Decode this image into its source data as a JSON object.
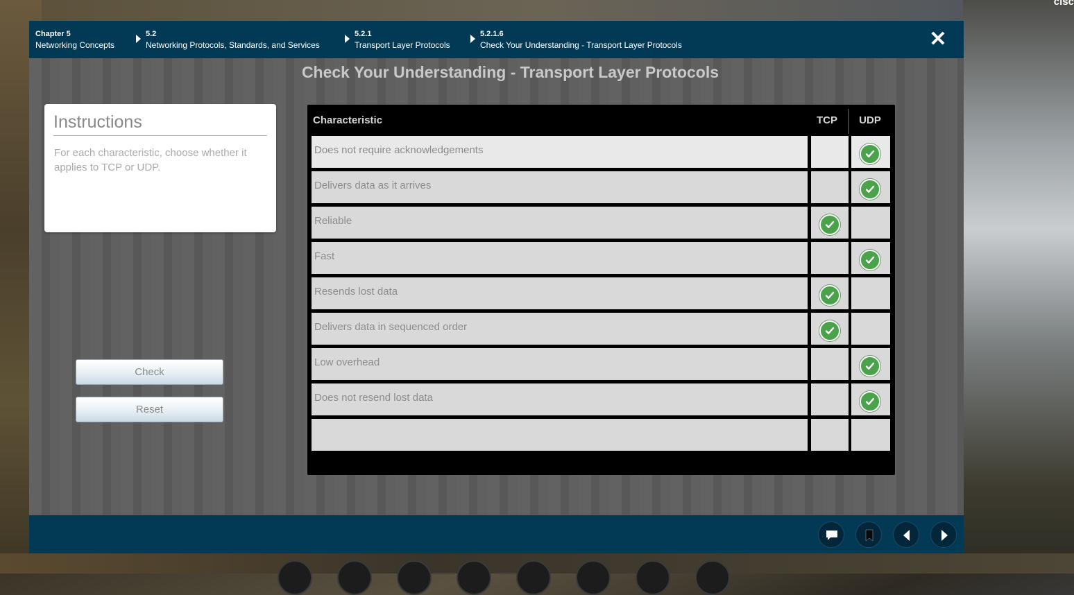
{
  "corner_brand": "cisc",
  "breadcrumbs": [
    {
      "num": "Chapter 5",
      "label": "Networking Concepts"
    },
    {
      "num": "5.2",
      "label": "Networking Protocols, Standards, and Services"
    },
    {
      "num": "5.2.1",
      "label": "Transport Layer Protocols"
    },
    {
      "num": "5.2.1.6",
      "label": "Check Your Understanding - Transport Layer Protocols"
    }
  ],
  "close_symbol": "✕",
  "activity_title": "Check Your Understanding - Transport Layer Protocols",
  "instructions": {
    "heading": "Instructions",
    "text": "For each characteristic, choose whether it applies to TCP or UDP."
  },
  "buttons": {
    "check": "Check",
    "reset": "Reset"
  },
  "table": {
    "headers": {
      "characteristic": "Characteristic",
      "tcp": "TCP",
      "udp": "UDP"
    },
    "rows": [
      {
        "label": "Does not require acknowledgements",
        "answer": "UDP"
      },
      {
        "label": "Delivers data as it arrives",
        "answer": "UDP"
      },
      {
        "label": "Reliable",
        "answer": "TCP"
      },
      {
        "label": "Fast",
        "answer": "UDP"
      },
      {
        "label": "Resends lost data",
        "answer": "TCP"
      },
      {
        "label": "Delivers data in sequenced order",
        "answer": "TCP"
      },
      {
        "label": "Low overhead",
        "answer": "UDP"
      },
      {
        "label": "Does not resend lost data",
        "answer": "UDP"
      },
      {
        "label": "",
        "answer": ""
      }
    ]
  },
  "footer_icons": [
    "comment-icon",
    "bookmark-icon",
    "previous-icon",
    "next-icon"
  ],
  "colors": {
    "nav": "#023a56",
    "check_green": "#4aa24a"
  }
}
